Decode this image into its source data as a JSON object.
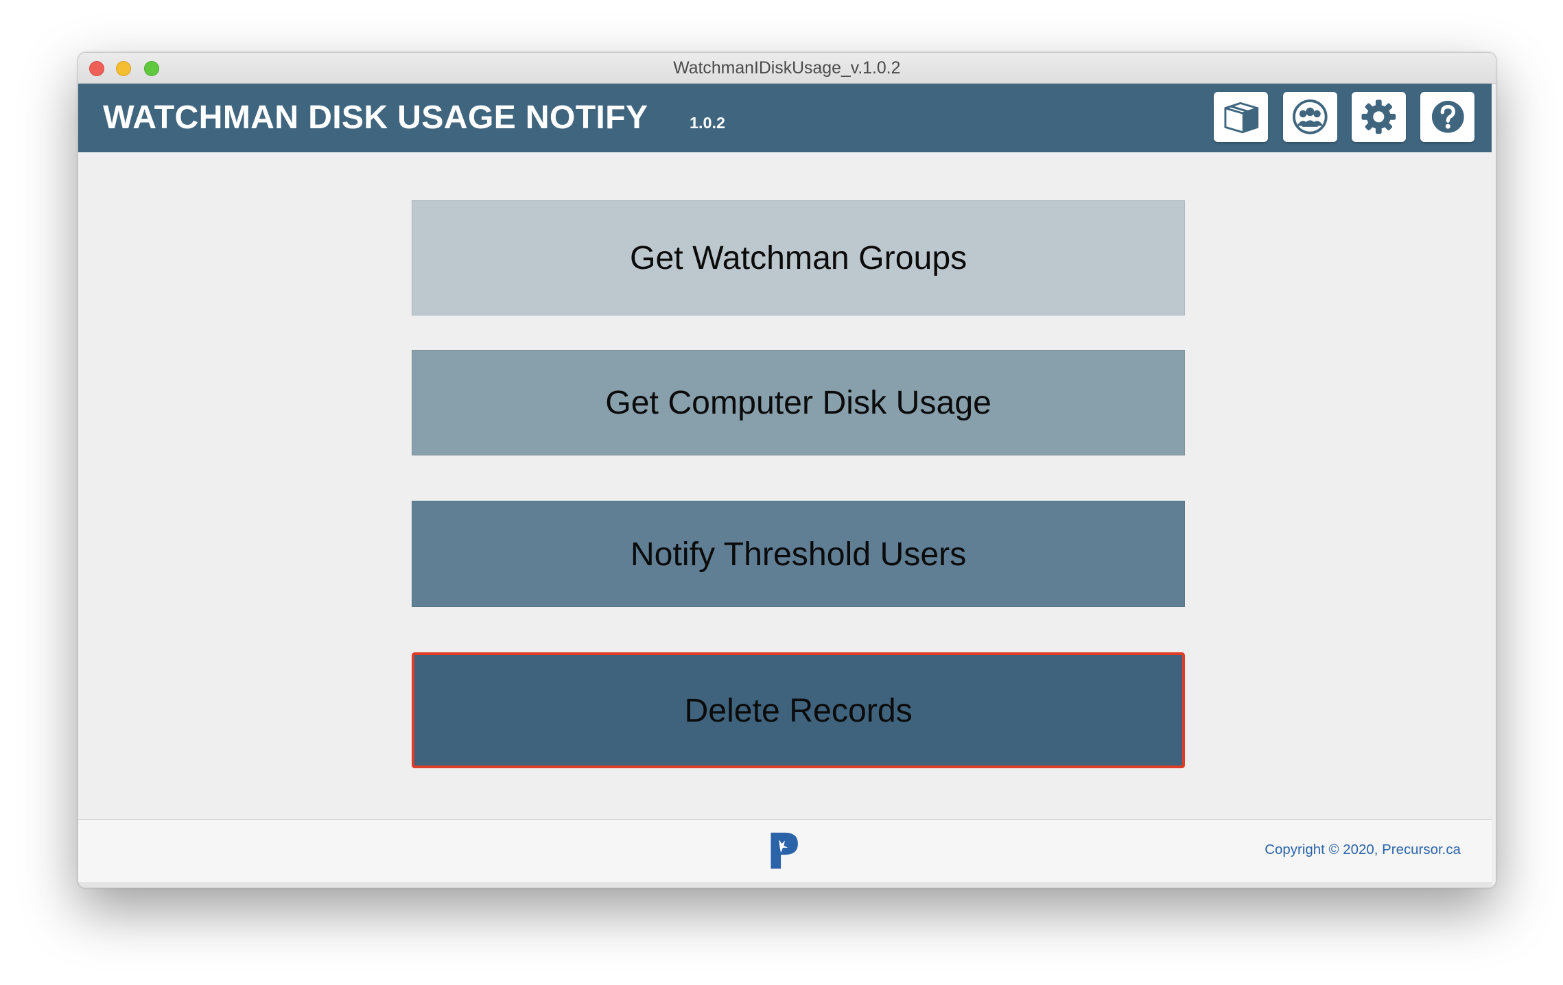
{
  "window": {
    "title": "WatchmanIDiskUsage_v.1.0.2"
  },
  "header": {
    "app_name": "WATCHMAN DISK USAGE NOTIFY",
    "version": "1.0.2",
    "icons": [
      "package-icon",
      "users-icon",
      "gear-icon",
      "help-icon"
    ]
  },
  "main": {
    "buttons": [
      {
        "label": "Get Watchman Groups",
        "color": "#bcc7ce"
      },
      {
        "label": "Get Computer Disk Usage",
        "color": "#889fac"
      },
      {
        "label": "Notify Threshold Users",
        "color": "#607f94"
      },
      {
        "label": "Delete Records",
        "color": "#3f637c",
        "focus_ring": "#de3d2a"
      }
    ]
  },
  "footer": {
    "logo": "precursor-logo",
    "copyright": "Copyright © 2020, Precursor.ca"
  },
  "colors": {
    "header_bg": "#3f657f",
    "link": "#2a63a8"
  }
}
